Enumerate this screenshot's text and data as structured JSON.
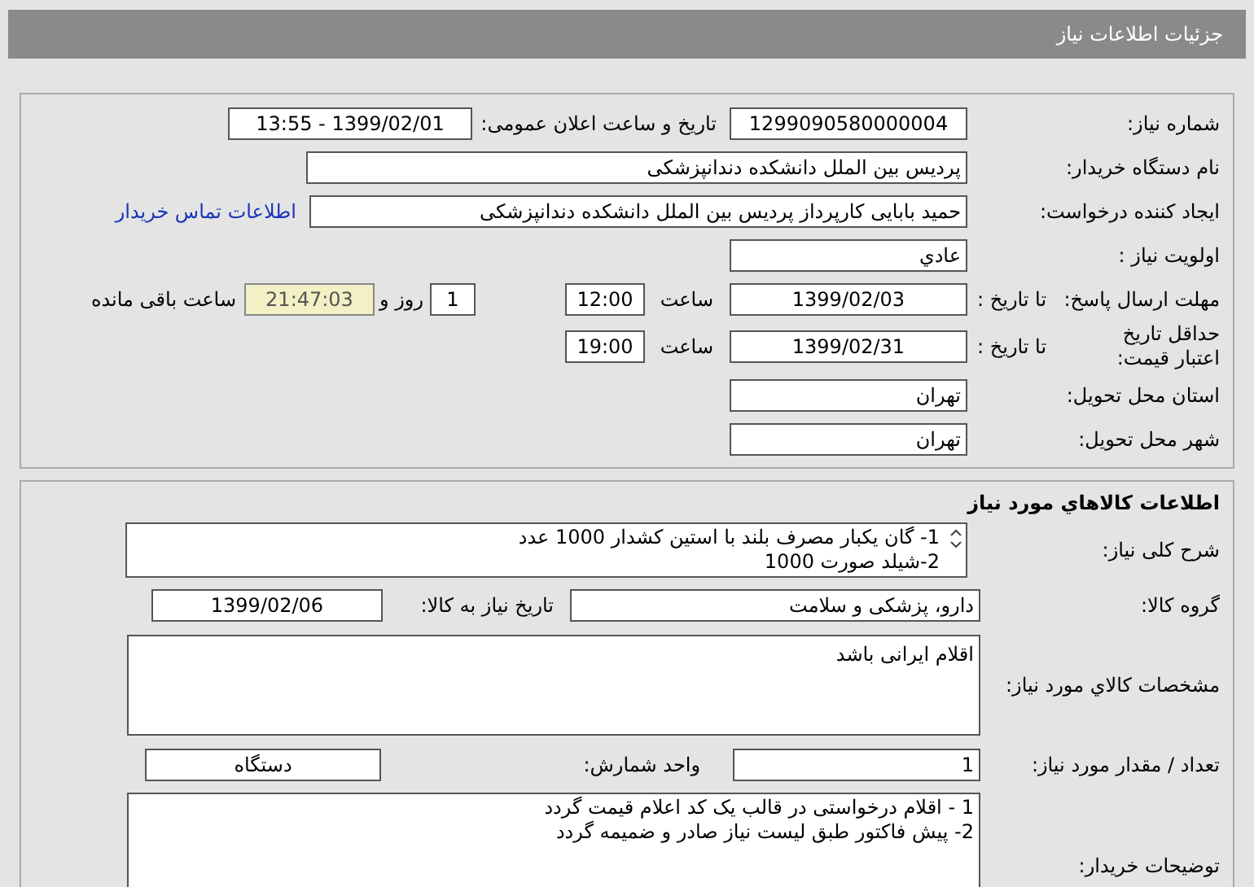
{
  "header": {
    "title": "جزئیات اطلاعات نیاز"
  },
  "details": {
    "need_number": {
      "label": "شماره نیاز:",
      "value": "1299090580000004"
    },
    "announce": {
      "label": "تاریخ و ساعت اعلان عمومی:",
      "value": "1399/02/01 - 13:55"
    },
    "buyer": {
      "label": "نام دستگاه خریدار:",
      "value": "پردیس بین الملل دانشکده دندانپزشکی"
    },
    "creator": {
      "label": "ایجاد کننده درخواست:",
      "value": "حمید بابایی کارپرداز پردیس بین الملل دانشکده دندانپزشکی"
    },
    "contact_link": "اطلاعات تماس خریدار",
    "priority": {
      "label": "اولویت نیاز :",
      "value": "عادي"
    },
    "deadline": {
      "label": "مهلت ارسال پاسخ:",
      "date_label": "تا تاریخ :",
      "date": "1399/02/03",
      "time_label": "ساعت",
      "time": "12:00",
      "days": "1",
      "days_label": "روز و",
      "remaining": "21:47:03",
      "remaining_label": "ساعت باقی مانده"
    },
    "validity": {
      "label": "حداقل تاریخ اعتبار قیمت:",
      "date_label": "تا تاریخ :",
      "date": "1399/02/31",
      "time_label": "ساعت",
      "time": "19:00"
    },
    "province": {
      "label": "استان محل تحویل:",
      "value": "تهران"
    },
    "city": {
      "label": "شهر محل تحویل:",
      "value": "تهران"
    }
  },
  "goods": {
    "title": "اطلاعات كالاهاي مورد نياز",
    "description": {
      "label": "شرح کلی نیاز:",
      "lines": [
        "1- گان یکبار مصرف بلند با استین کشدار 1000 عدد",
        "2-شیلد صورت 1000"
      ]
    },
    "group": {
      "label": "گروه کالا:",
      "value": "دارو، پزشکی و سلامت"
    },
    "need_date": {
      "label": "تاریخ نیاز به کالا:",
      "value": "1399/02/06"
    },
    "specs": {
      "label": "مشخصات كالاي مورد نياز:",
      "value": "اقلام ایرانی باشد"
    },
    "quantity": {
      "label": "تعداد / مقدار مورد نیاز:",
      "value": "1"
    },
    "unit": {
      "label": "واحد شمارش:",
      "value": "دستگاه"
    },
    "notes": {
      "label": "توضیحات خریدار:",
      "lines": [
        "1 - اقلام درخواستی در قالب یک کد اعلام قیمت گردد",
        "2- پیش فاکتور طبق لیست نیاز صادر و ضمیمه گردد"
      ]
    }
  }
}
